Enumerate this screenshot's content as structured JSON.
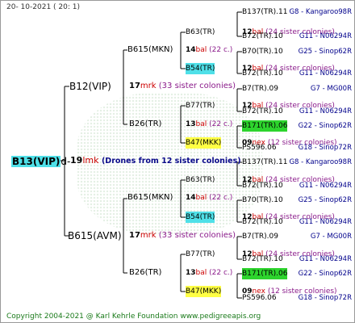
{
  "date": "20- 10-2021 ( 20: 1)",
  "footer": "Copyright 2004-2021 @ Karl Kehrle Foundation    www.pedigreeapis.org",
  "root": {
    "name": "B13(VIP)",
    "link": "d-",
    "count": "19",
    "mark": "lmk",
    "desc": "(Drones from 12 sister colonies)"
  },
  "nodes": [
    {
      "id": "p",
      "label": "B12(VIP)"
    },
    {
      "id": "pc",
      "num": "17",
      "mark": "mrk",
      "desc": "(33 sister colonies)"
    },
    {
      "id": "pa",
      "label": "B615(MKN)"
    },
    {
      "id": "pac",
      "num": "14",
      "mark": "bal",
      "desc": "(22 c.)"
    },
    {
      "id": "paa",
      "label": "B63(TR)"
    },
    {
      "id": "paac",
      "num": "12",
      "mark": "bal",
      "desc": "(24 sister colonies)"
    },
    {
      "id": "pab",
      "label": "B54(TR)"
    },
    {
      "id": "pabc",
      "num": "12",
      "mark": "bal",
      "desc": "(24 sister colonies)"
    },
    {
      "id": "pb",
      "label": "B26(TR)"
    },
    {
      "id": "pbc",
      "num": "13",
      "mark": "bal",
      "desc": "(22 c.)"
    },
    {
      "id": "pba",
      "label": "B77(TR)"
    },
    {
      "id": "pbac",
      "num": "12",
      "mark": "bal",
      "desc": "(24 sister colonies)"
    },
    {
      "id": "pbb",
      "label": "B47(MKK)"
    },
    {
      "id": "pbbc",
      "num": "09",
      "mark": "nex",
      "desc": "(12 sister colonies)"
    },
    {
      "id": "m",
      "label": "B615(AVM)"
    },
    {
      "id": "mc",
      "num": "17",
      "mark": "mrk",
      "desc": "(33 sister colonies)"
    },
    {
      "id": "ma",
      "label": "B615(MKN)"
    },
    {
      "id": "mac",
      "num": "14",
      "mark": "bal",
      "desc": "(22 c.)"
    },
    {
      "id": "maa",
      "label": "B63(TR)"
    },
    {
      "id": "maac",
      "num": "12",
      "mark": "bal",
      "desc": "(24 sister colonies)"
    },
    {
      "id": "mab",
      "label": "B54(TR)"
    },
    {
      "id": "mabc",
      "num": "12",
      "mark": "bal",
      "desc": "(24 sister colonies)"
    },
    {
      "id": "mb",
      "label": "B26(TR)"
    },
    {
      "id": "mbc",
      "num": "13",
      "mark": "bal",
      "desc": "(22 c.)"
    },
    {
      "id": "mba",
      "label": "B77(TR)"
    },
    {
      "id": "mbac",
      "num": "12",
      "mark": "bal",
      "desc": "(24 sister colonies)"
    },
    {
      "id": "mbb",
      "label": "B47(MKK)"
    },
    {
      "id": "mbbc",
      "num": "09",
      "mark": "nex",
      "desc": "(12 sister colonies)"
    }
  ],
  "leaves": [
    {
      "name": "B137(TR).11",
      "src": "G8 - Kangaroo98R"
    },
    {
      "name": "B72(TR).10",
      "src": "G11 - N06294R"
    },
    {
      "name": "B70(TR).10",
      "src": "G25 - Sinop62R"
    },
    {
      "name": "B72(TR).10",
      "src": "G11 - N06294R"
    },
    {
      "name": "B7(TR).09",
      "src": "G7 - MG00R"
    },
    {
      "name": "B72(TR).10",
      "src": "G11 - N06294R"
    },
    {
      "name": "B171(TR).06",
      "src": "G22 - Sinop62R"
    },
    {
      "name": "PS596.06",
      "src": "G18 - Sinop72R"
    },
    {
      "name": "B137(TR).11",
      "src": "G8 - Kangaroo98R"
    },
    {
      "name": "B72(TR).10",
      "src": "G11 - N06294R"
    },
    {
      "name": "B70(TR).10",
      "src": "G25 - Sinop62R"
    },
    {
      "name": "B72(TR).10",
      "src": "G11 - N06294R"
    },
    {
      "name": "B7(TR).09",
      "src": "G7 - MG00R"
    },
    {
      "name": "B72(TR).10",
      "src": "G11 - N06294R"
    },
    {
      "name": "B171(TR).06",
      "src": "G22 - Sinop62R"
    },
    {
      "name": "PS596.06",
      "src": "G18 - Sinop72R"
    }
  ],
  "colors": {
    "cyan": "#4fe0e8",
    "yellow": "#ffff44",
    "green": "#2dd42d",
    "lines": "#000000"
  }
}
